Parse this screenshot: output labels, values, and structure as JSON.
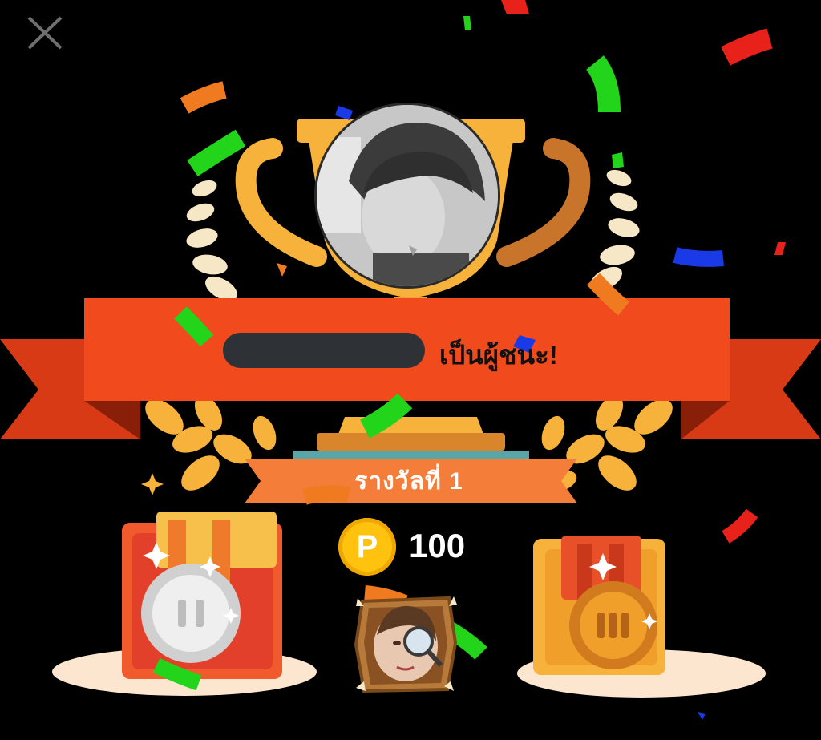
{
  "dialog": {
    "winner_suffix": "เป็นผู้ชนะ!",
    "rank_label": "รางวัลที่ 1",
    "coin_letter": "P",
    "reward_amount": "100"
  },
  "colors": {
    "banner": "#f04a1d",
    "ribbon_tail": "#d93a16",
    "rank_ribbon": "#f47d3a",
    "gold": "#f6b23a",
    "coin": "#ffc20e",
    "background": "#000000"
  },
  "icons": {
    "close": "close-icon",
    "trophy": "trophy-icon",
    "silver_medal": "silver-medal-icon",
    "bronze_medal": "bronze-medal-icon",
    "coin": "coin-icon",
    "badge": "detective-badge-icon"
  }
}
